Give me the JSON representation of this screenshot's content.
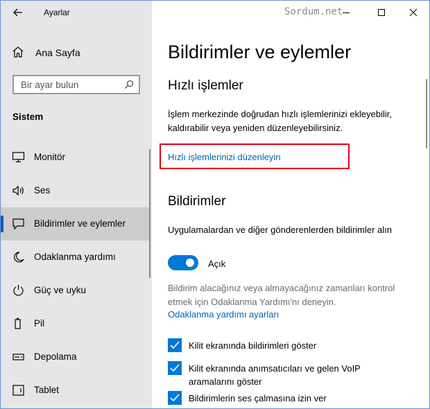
{
  "window": {
    "title": "Ayarlar",
    "brand": "Sordum.net"
  },
  "sidebar": {
    "home": "Ana Sayfa",
    "search_placeholder": "Bir ayar bulun",
    "section": "Sistem",
    "items": [
      {
        "label": "Monitör",
        "icon": "monitor-icon"
      },
      {
        "label": "Ses",
        "icon": "speaker-icon"
      },
      {
        "label": "Bildirimler ve eylemler",
        "icon": "notification-icon",
        "active": true
      },
      {
        "label": "Odaklanma yardımı",
        "icon": "moon-icon"
      },
      {
        "label": "Güç ve uyku",
        "icon": "power-icon"
      },
      {
        "label": "Pil",
        "icon": "battery-icon"
      },
      {
        "label": "Depolama",
        "icon": "storage-icon"
      },
      {
        "label": "Tablet",
        "icon": "tablet-icon"
      }
    ]
  },
  "main": {
    "title": "Bildirimler ve eylemler",
    "quick_actions": {
      "heading": "Hızlı işlemler",
      "description": "İşlem merkezinde doğrudan hızlı işlemlerinizi ekleyebilir, kaldırabilir veya yeniden düzenleyebilirsiniz.",
      "link": "Hızlı işlemlerinizi düzenleyin"
    },
    "notifications": {
      "heading": "Bildirimler",
      "toggle_label": "Uygulamalardan ve diğer gönderenlerden bildirimler alın",
      "toggle_state": "Açık",
      "toggle_on": true,
      "focus_hint": "Bildirim alacağınız veya almayacağınız zamanları kontrol etmek için Odaklanma Yardımı'nı deneyin.",
      "focus_link": "Odaklanma yardımı ayarları",
      "checkboxes": [
        {
          "label": "Kilit ekranında bildirimleri göster",
          "checked": true
        },
        {
          "label": "Kilit ekranında anımsatıcıları ve gelen VoIP aramalarını göster",
          "checked": true
        },
        {
          "label": "Bildirimlerin ses çalmasına izin ver",
          "checked": true
        }
      ]
    }
  },
  "colors": {
    "accent": "#0078d7",
    "link": "#0063b1",
    "highlight_box": "#e3001b",
    "sidebar_bg": "#e6e6e6"
  }
}
